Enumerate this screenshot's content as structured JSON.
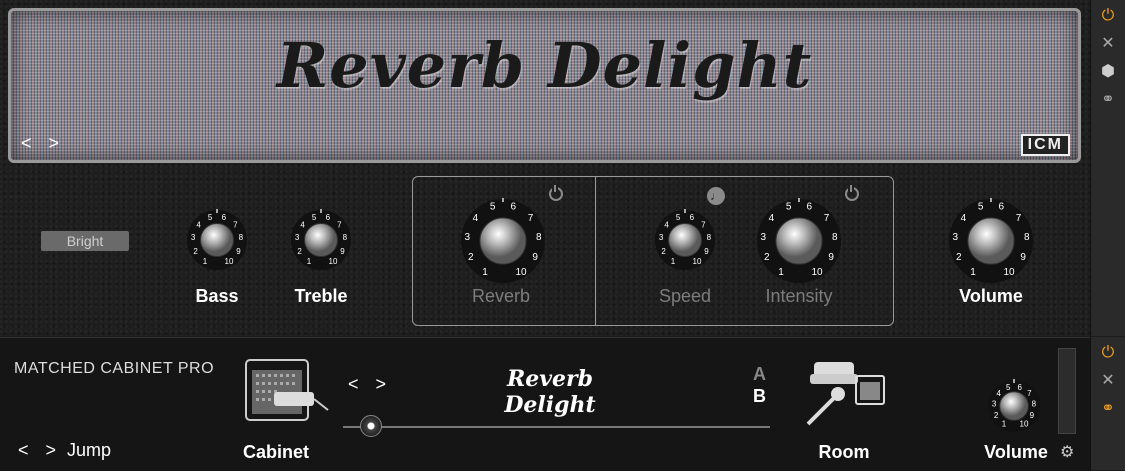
{
  "amp": {
    "logo": "Reverb Delight",
    "nav": "< >",
    "brand_badge": "ICM",
    "bright_label": "Bright",
    "knobs": [
      {
        "name": "bass",
        "label": "Bass",
        "scale": [
          "1",
          "2",
          "3",
          "4",
          "5",
          "6",
          "7",
          "8",
          "9",
          "10"
        ],
        "active": true
      },
      {
        "name": "treble",
        "label": "Treble",
        "scale": [
          "1",
          "2",
          "3",
          "4",
          "5",
          "6",
          "7",
          "8",
          "9",
          "10"
        ],
        "active": true
      },
      {
        "name": "reverb",
        "label": "Reverb",
        "scale": [
          "1",
          "2",
          "3",
          "4",
          "5",
          "6",
          "7",
          "8",
          "9",
          "10"
        ],
        "active": false
      },
      {
        "name": "speed",
        "label": "Speed",
        "scale": [
          "1",
          "2",
          "3",
          "4",
          "5",
          "6",
          "7",
          "8",
          "9",
          "10"
        ],
        "active": false
      },
      {
        "name": "intensity",
        "label": "Intensity",
        "scale": [
          "1",
          "2",
          "3",
          "4",
          "5",
          "6",
          "7",
          "8",
          "9",
          "10"
        ],
        "active": false
      },
      {
        "name": "volume",
        "label": "Volume",
        "scale": [
          "1",
          "2",
          "3",
          "4",
          "5",
          "6",
          "7",
          "8",
          "9",
          "10"
        ],
        "active": true
      }
    ]
  },
  "cabinet": {
    "title": "MATCHED CABINET PRO",
    "jump_label": "Jump",
    "jump_nav": "< >",
    "cabinet_label": "Cabinet",
    "nav": "< >",
    "current_name": "Reverb Delight",
    "slot_a": "A",
    "slot_b": "B",
    "room_label": "Room",
    "volume_label": "Volume"
  },
  "sidebar": {
    "power_icon": "power-icon",
    "collapse_icon": "collapse-icon",
    "preset_icon": "hexagon-icon",
    "link_icon": "link-rings-icon"
  },
  "colors": {
    "accent": "#f0a020",
    "background": "#1b1b1b"
  }
}
